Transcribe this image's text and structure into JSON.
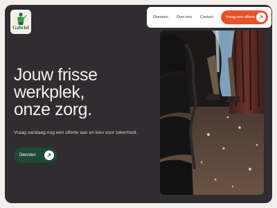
{
  "brand": {
    "name": "Gabriel"
  },
  "nav": {
    "links": [
      "Diensten",
      "Over ons",
      "Contact"
    ],
    "cta_label": "Vraag een offerte"
  },
  "hero": {
    "headline": [
      "Jouw frisse",
      "werkplek,",
      "onze zorg."
    ],
    "subtext": "Vraag vandaag nog een offerte aan en kies voor zekerheid.",
    "button_label": "Diensten"
  },
  "icons": {
    "cta": "arrow-up-right-icon",
    "button": "arrow-up-right-icon",
    "logo": "cleaning-figure-icon"
  },
  "colors": {
    "background": "#302d31",
    "accent": "#e4532a",
    "button": "#1e4a33",
    "logo_green": "#20643a"
  }
}
